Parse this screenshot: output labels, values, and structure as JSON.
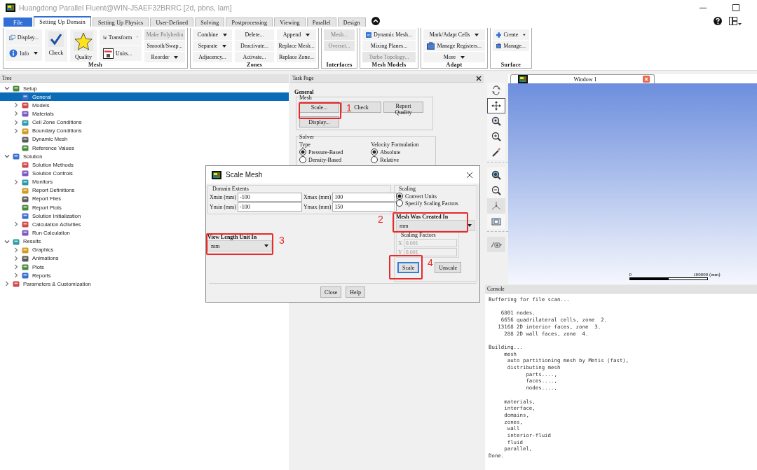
{
  "window": {
    "title": "Huangdong Parallel Fluent@WIN-J5AEF32BRRC  [2d, pbns, lam]"
  },
  "ribbon": {
    "tabs": [
      {
        "label": "File",
        "kind": "file",
        "selected": false
      },
      {
        "label": "Setting Up Domain",
        "kind": "tab",
        "selected": true
      },
      {
        "label": "Setting Up Physics",
        "kind": "tab",
        "selected": false
      },
      {
        "label": "User-Defined",
        "kind": "tab",
        "selected": false
      },
      {
        "label": "Solving",
        "kind": "tab",
        "selected": false
      },
      {
        "label": "Postprocessing",
        "kind": "tab",
        "selected": false
      },
      {
        "label": "Viewing",
        "kind": "tab",
        "selected": false
      },
      {
        "label": "Parallel",
        "kind": "tab",
        "selected": false
      },
      {
        "label": "Design",
        "kind": "tab",
        "selected": false
      }
    ],
    "groups": [
      {
        "title": "Mesh",
        "columns": [
          [
            {
              "label": "Display...",
              "kind": "small"
            },
            {
              "label": "Info",
              "kind": "small",
              "dropdown": true
            }
          ],
          [
            {
              "label": "Check",
              "kind": "large"
            }
          ],
          [
            {
              "label": "Quality",
              "kind": "large"
            }
          ],
          [
            {
              "label": "Transform",
              "kind": "small",
              "dropdown": true
            },
            {
              "label": "Units...",
              "kind": "small"
            }
          ],
          [
            {
              "label": "Make Polyhedra",
              "kind": "plain",
              "disabled": true
            },
            {
              "label": "Smooth/Swap...",
              "kind": "plain"
            },
            {
              "label": "Reorder",
              "kind": "plain",
              "dropdown": true
            }
          ]
        ]
      },
      {
        "title": "Zones",
        "columns": [
          [
            {
              "label": "Combine",
              "kind": "plain",
              "dropdown": true
            },
            {
              "label": "Separate",
              "kind": "plain",
              "dropdown": true
            },
            {
              "label": "Adjacency...",
              "kind": "plain"
            }
          ],
          [
            {
              "label": "Delete...",
              "kind": "plain"
            },
            {
              "label": "Deactivate...",
              "kind": "plain"
            },
            {
              "label": "Activate...",
              "kind": "plain"
            }
          ],
          [
            {
              "label": "Append",
              "kind": "plain",
              "dropdown": true
            },
            {
              "label": "Replace Mesh...",
              "kind": "plain"
            },
            {
              "label": "Replace Zone...",
              "kind": "plain"
            }
          ]
        ]
      },
      {
        "title": "Interfaces",
        "columns": [
          [
            {
              "label": "Mesh...",
              "kind": "plain",
              "disabled": true
            },
            {
              "label": "Overset...",
              "kind": "plain",
              "disabled": true
            }
          ]
        ]
      },
      {
        "title": "Mesh Models",
        "columns": [
          [
            {
              "label": "Dynamic Mesh...",
              "kind": "small"
            },
            {
              "label": "Mixing Planes...",
              "kind": "plain"
            },
            {
              "label": "Turbo Topology...",
              "kind": "plain",
              "disabled": true
            }
          ]
        ]
      },
      {
        "title": "Adapt",
        "columns": [
          [
            {
              "label": "Mark/Adapt Cells",
              "kind": "plain",
              "dropdown": true
            },
            {
              "label": "Manage Registers...",
              "kind": "small"
            },
            {
              "label": "More",
              "kind": "plain",
              "dropdown": true
            }
          ]
        ]
      },
      {
        "title": "Surface",
        "columns": [
          [
            {
              "label": "Create",
              "kind": "small",
              "dropdown": true
            },
            {
              "label": "Manage...",
              "kind": "small"
            }
          ]
        ]
      }
    ]
  },
  "tree": {
    "title": "Tree",
    "items": [
      {
        "label": "Setup",
        "expanded": true,
        "selected": false,
        "children": [
          {
            "label": "General",
            "selected": true
          },
          {
            "label": "Models",
            "expanded": false,
            "selected": false
          },
          {
            "label": "Materials",
            "expanded": false,
            "selected": false
          },
          {
            "label": "Cell Zone Conditions",
            "expanded": false,
            "selected": false
          },
          {
            "label": "Boundary Conditions",
            "expanded": false,
            "selected": false
          },
          {
            "label": "Dynamic Mesh",
            "selected": false
          },
          {
            "label": "Reference Values",
            "selected": false
          }
        ]
      },
      {
        "label": "Solution",
        "expanded": true,
        "selected": false,
        "children": [
          {
            "label": "Solution Methods",
            "selected": false
          },
          {
            "label": "Solution Controls",
            "selected": false
          },
          {
            "label": "Monitors",
            "expanded": false,
            "selected": false
          },
          {
            "label": "Report Definitions",
            "selected": false
          },
          {
            "label": "Report Files",
            "selected": false
          },
          {
            "label": "Report Plots",
            "selected": false
          },
          {
            "label": "Solution Initialization",
            "selected": false
          },
          {
            "label": "Calculation Activities",
            "expanded": false,
            "selected": false
          },
          {
            "label": "Run Calculation",
            "selected": false
          }
        ]
      },
      {
        "label": "Results",
        "expanded": true,
        "selected": false,
        "children": [
          {
            "label": "Graphics",
            "expanded": false,
            "selected": false
          },
          {
            "label": "Animations",
            "expanded": false,
            "selected": false
          },
          {
            "label": "Plots",
            "expanded": false,
            "selected": false
          },
          {
            "label": "Reports",
            "expanded": false,
            "selected": false
          }
        ]
      },
      {
        "label": "Parameters & Customization",
        "expanded": false,
        "selected": false
      }
    ]
  },
  "task_page": {
    "title": "Task Page",
    "heading": "General",
    "mesh_group": {
      "title": "Mesh",
      "buttons": [
        "Scale...",
        "Check",
        "Report Quality",
        "Display..."
      ]
    },
    "solver_group": {
      "title": "Solver",
      "type": {
        "label": "Type",
        "options": [
          {
            "label": "Pressure-Based",
            "selected": true
          },
          {
            "label": "Density-Based",
            "selected": false
          }
        ]
      },
      "velocity_formulation": {
        "label": "Velocity Formulation",
        "options": [
          {
            "label": "Absolute",
            "selected": true
          },
          {
            "label": "Relative",
            "selected": false
          }
        ]
      }
    }
  },
  "graphics": {
    "tab": "Window 1",
    "scale_start": "0",
    "scale_end": "100000 (mm)"
  },
  "console": {
    "title": "Console",
    "blocks": [
      [
        "Buffering for file scan..."
      ],
      [
        "    6801 nodes.",
        "    6656 quadrilateral cells, zone  2.",
        "   13168 2D interior faces, zone  3.",
        "     288 2D wall faces, zone  4."
      ],
      [
        "Building...",
        "     mesh",
        "      auto partitioning mesh by Metis (fast),",
        "      distributing mesh",
        "            parts....,",
        "            faces....,",
        "            nodes....,"
      ],
      [
        "     materials,",
        "     interface,",
        "     domains,",
        "     zones,",
        "      wall",
        "      interior-fluid",
        "      fluid",
        "     parallel,",
        "Done."
      ]
    ]
  },
  "dialog": {
    "title": "Scale Mesh",
    "domain_extents": {
      "title": "Domain Extents",
      "fields": [
        {
          "label": "Xmin (mm)",
          "value": "-100"
        },
        {
          "label": "Xmax (mm)",
          "value": "100"
        },
        {
          "label": "Ymin (mm)",
          "value": "-100"
        },
        {
          "label": "Ymax (mm)",
          "value": "150"
        }
      ]
    },
    "view_length_unit": {
      "label": "View Length Unit In",
      "value": "mm"
    },
    "scaling": {
      "title": "Scaling",
      "options": [
        {
          "label": "Convert Units",
          "selected": true
        },
        {
          "label": "Specify Scaling Factors",
          "selected": false
        }
      ],
      "mesh_created_in": {
        "label": "Mesh Was Created In",
        "value": "mm"
      },
      "factors": {
        "title": "Scaling Factors",
        "fields": [
          {
            "label": "X",
            "value": "0.001",
            "disabled": true
          },
          {
            "label": "Y",
            "value": "0.001",
            "disabled": true
          }
        ]
      },
      "buttons": [
        {
          "label": "Scale",
          "focused": true
        },
        {
          "label": "Unscale",
          "focused": false
        }
      ]
    },
    "buttons": [
      "Close",
      "Help"
    ]
  },
  "annotations": [
    {
      "label": "1"
    },
    {
      "label": "2"
    },
    {
      "label": "3"
    },
    {
      "label": "4"
    }
  ]
}
